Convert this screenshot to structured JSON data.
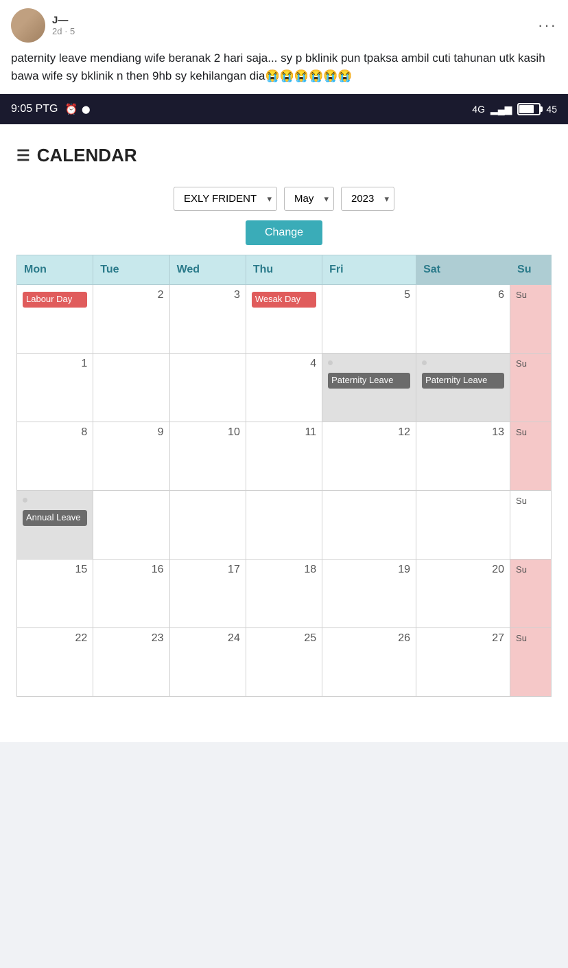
{
  "post": {
    "username": "J—",
    "time": "2d · 5",
    "text": "paternity leave mendiang wife beranak 2 hari saja... sy p bklinik pun tpaksa ambil cuti tahunan utk kasih bawa wife sy bklinik n then 9hb sy kehilangan dia😭😭😭😭😭😭",
    "more_label": "···"
  },
  "status_bar": {
    "time": "9:05 PTG",
    "network": "4G",
    "battery": "45"
  },
  "calendar": {
    "title": "CALENDAR",
    "title_icon": "☰",
    "filter": {
      "company": "EXLY FRIDENT",
      "month": "May",
      "year": "2023",
      "change_label": "Change"
    },
    "headers": [
      "Mon",
      "Tue",
      "Wed",
      "Thu",
      "Fri",
      "Sat",
      "Su"
    ],
    "weeks": [
      {
        "mon": {
          "num": "",
          "event": "Labour Day",
          "event_type": "holiday"
        },
        "tue": {
          "num": "2"
        },
        "wed": {
          "num": "3"
        },
        "thu": {
          "num": "",
          "event": "Wesak Day",
          "event_type": "holiday"
        },
        "fri": {
          "num": "5"
        },
        "sat": {
          "num": "6"
        },
        "sun": {
          "num": "",
          "label": "Su",
          "type": "partial"
        }
      },
      {
        "mon": {
          "num": "1"
        },
        "tue": {
          "num": ""
        },
        "wed": {
          "num": ""
        },
        "thu": {
          "num": "4"
        },
        "fri": {
          "num": "",
          "event": "Paternity Leave",
          "event_type": "paternity",
          "dot": true
        },
        "sat": {
          "num": "",
          "event": "Paternity Leave",
          "event_type": "paternity",
          "dot": true
        },
        "sun": {
          "num": "",
          "label": "Su",
          "type": "partial"
        }
      },
      {
        "mon": {
          "num": "8"
        },
        "tue": {
          "num": "9"
        },
        "wed": {
          "num": "10"
        },
        "thu": {
          "num": "11"
        },
        "fri": {
          "num": "12"
        },
        "sat": {
          "num": "13"
        },
        "sun": {
          "num": "",
          "label": "Su",
          "type": "partial",
          "weekend": true
        }
      },
      {
        "mon": {
          "num": "",
          "event": "Annual Leave",
          "event_type": "annual",
          "dot": true
        },
        "tue": {
          "num": ""
        },
        "wed": {
          "num": ""
        },
        "thu": {
          "num": ""
        },
        "fri": {
          "num": ""
        },
        "sat": {
          "num": ""
        },
        "sun": {
          "num": "",
          "label": "Su",
          "type": "partial"
        }
      },
      {
        "mon": {
          "num": "15"
        },
        "tue": {
          "num": "16"
        },
        "wed": {
          "num": "17"
        },
        "thu": {
          "num": "18"
        },
        "fri": {
          "num": "19"
        },
        "sat": {
          "num": "20"
        },
        "sun": {
          "num": "",
          "label": "Su",
          "type": "partial",
          "weekend": true
        }
      },
      {
        "mon": {
          "num": "22"
        },
        "tue": {
          "num": "23"
        },
        "wed": {
          "num": "24"
        },
        "thu": {
          "num": "25"
        },
        "fri": {
          "num": "26"
        },
        "sat": {
          "num": "27"
        },
        "sun": {
          "num": "",
          "label": "Su",
          "type": "partial",
          "weekend": true
        }
      }
    ]
  }
}
